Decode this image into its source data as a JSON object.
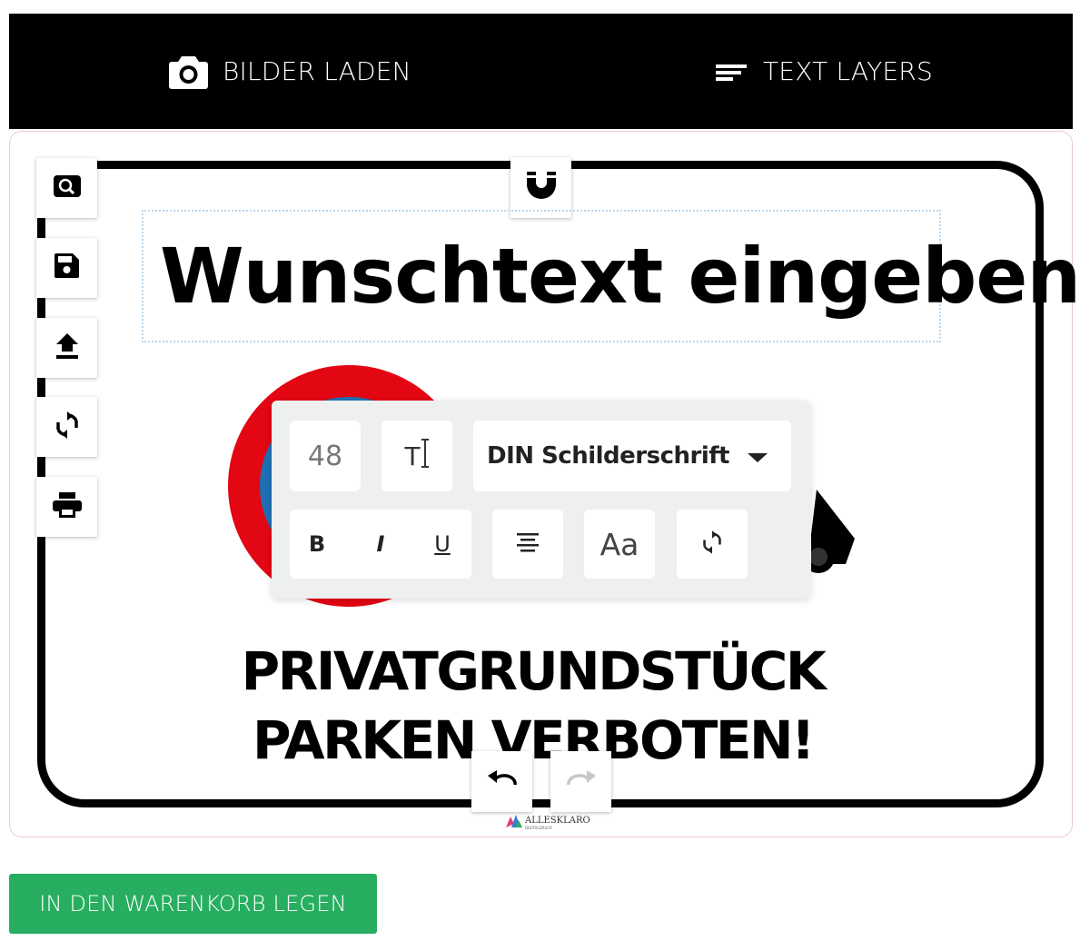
{
  "header": {
    "tabs": [
      {
        "label": "BILDER LADEN",
        "icon": "camera-icon"
      },
      {
        "label": "TEXT LAYERS",
        "icon": "text-lines-icon"
      }
    ]
  },
  "side_tools": [
    {
      "icon": "zoom-icon"
    },
    {
      "icon": "save-icon"
    },
    {
      "icon": "upload-icon"
    },
    {
      "icon": "rotate-icon"
    },
    {
      "icon": "print-icon"
    }
  ],
  "editor": {
    "text_layer_value": "Wunschtext eingeben",
    "snap_icon": "magnet-icon"
  },
  "text_toolbar": {
    "font_size": "48",
    "text_cursor_symbol": "T",
    "font_family": "DIN Schilderschrift",
    "bold": "B",
    "italic": "I",
    "underline": "U",
    "case_toggle": "Aa",
    "align_icon": "align-center-icon",
    "reset_icon": "refresh-icon"
  },
  "sign": {
    "line1": "PRIVATGRUNDSTÜCK",
    "line2": "PARKEN VERBOTEN!",
    "colors": {
      "ring": "#e30613",
      "center": "#1f6fb5",
      "border": "#000000"
    }
  },
  "history": {
    "undo_icon": "undo-icon",
    "redo_icon": "redo-icon"
  },
  "branding": {
    "logo_name": "ALLESKLARO",
    "logo_sub": "DIGITALDRUCK"
  },
  "actions": {
    "cart_label": "IN DEN WARENKORB LEGEN"
  },
  "colors": {
    "accent": "#27ae60",
    "topbar": "#000000",
    "toolbar_bg": "#eef0f0"
  }
}
